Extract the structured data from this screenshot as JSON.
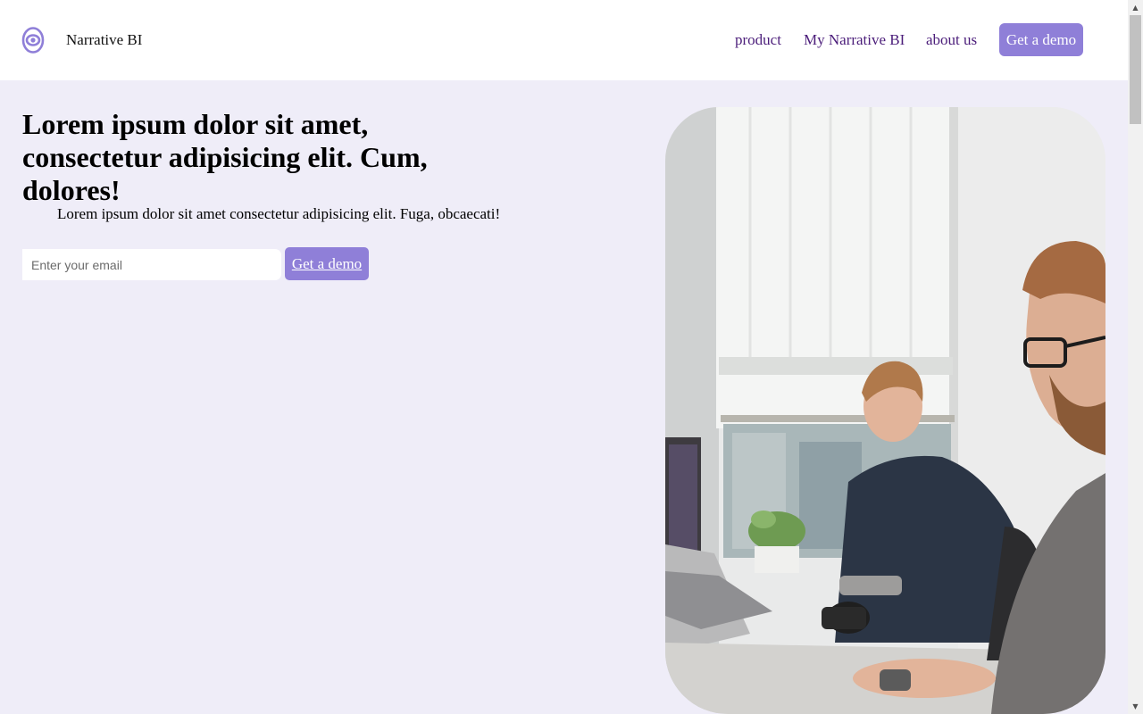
{
  "colors": {
    "accent": "#8f7fd8",
    "nav_link": "#4b1d7a",
    "hero_background": "#efedf8",
    "header_background": "#ffffff"
  },
  "header": {
    "logo_icon": "concentric-circles-logo-icon",
    "brand": "Narrative BI",
    "nav": {
      "product": "product",
      "my_narrative": "My Narrative BI",
      "about": "about us"
    },
    "cta_label": "Get a demo"
  },
  "hero": {
    "title": "Lorem ipsum dolor sit amet, consectetur adipisicing elit. Cum, dolores!",
    "subtitle": "Lorem ipsum dolor sit amet consectetur adipisicing elit. Fuga, obcaecati!",
    "email_placeholder": "Enter your email",
    "email_value": "",
    "cta_label": "Get a demo",
    "photo_subject": "two men working at computers in an office"
  },
  "scrollbar": {
    "up_icon": "scroll-up-arrow-icon",
    "down_icon": "scroll-down-arrow-icon"
  }
}
